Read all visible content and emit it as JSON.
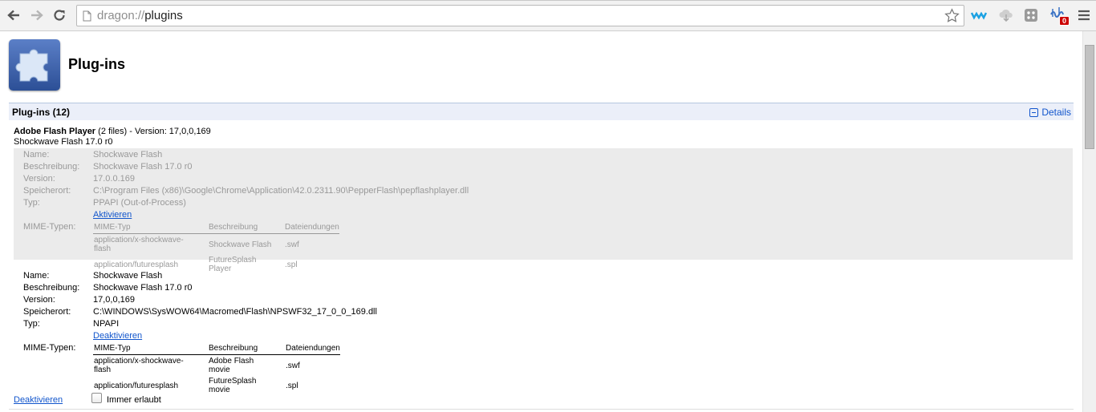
{
  "browser": {
    "url_scheme": "dragon://",
    "url_path": "plugins",
    "badge_count": "0"
  },
  "page": {
    "title": "Plug-ins",
    "section_title": "Plug-ins (12)",
    "details_label": "Details"
  },
  "plugin": {
    "name": "Adobe Flash Player",
    "files": "(2 files)",
    "version_text": "- Version: 17,0,0,169",
    "subtitle": "Shockwave Flash 17.0 r0"
  },
  "labels": {
    "name": "Name:",
    "description": "Beschreibung:",
    "version": "Version:",
    "location": "Speicherort:",
    "type": "Typ:",
    "mime": "MIME-Typen:",
    "mime_col_type": "MIME-Typ",
    "mime_col_desc": "Beschreibung",
    "mime_col_ext": "Dateiendungen"
  },
  "file1": {
    "name": "Shockwave Flash",
    "description": "Shockwave Flash 17.0 r0",
    "version": "17.0.0.169",
    "location": "C:\\Program Files (x86)\\Google\\Chrome\\Application\\42.0.2311.90\\PepperFlash\\pepflashplayer.dll",
    "type": "PPAPI (Out-of-Process)",
    "action": "Aktivieren",
    "mime_rows": [
      {
        "type": "application/x-shockwave-flash",
        "desc": "Shockwave Flash",
        "ext": ".swf"
      },
      {
        "type": "application/futuresplash",
        "desc": "FutureSplash Player",
        "ext": ".spl"
      }
    ]
  },
  "file2": {
    "name": "Shockwave Flash",
    "description": "Shockwave Flash 17.0 r0",
    "version": "17,0,0,169",
    "location": "C:\\WINDOWS\\SysWOW64\\Macromed\\Flash\\NPSWF32_17_0_0_169.dll",
    "type": "NPAPI",
    "action": "Deaktivieren",
    "mime_rows": [
      {
        "type": "application/x-shockwave-flash",
        "desc": "Adobe Flash movie",
        "ext": ".swf"
      },
      {
        "type": "application/futuresplash",
        "desc": "FutureSplash movie",
        "ext": ".spl"
      }
    ]
  },
  "footer": {
    "disable_link": "Deaktivieren",
    "always_allowed": "Immer erlaubt"
  }
}
